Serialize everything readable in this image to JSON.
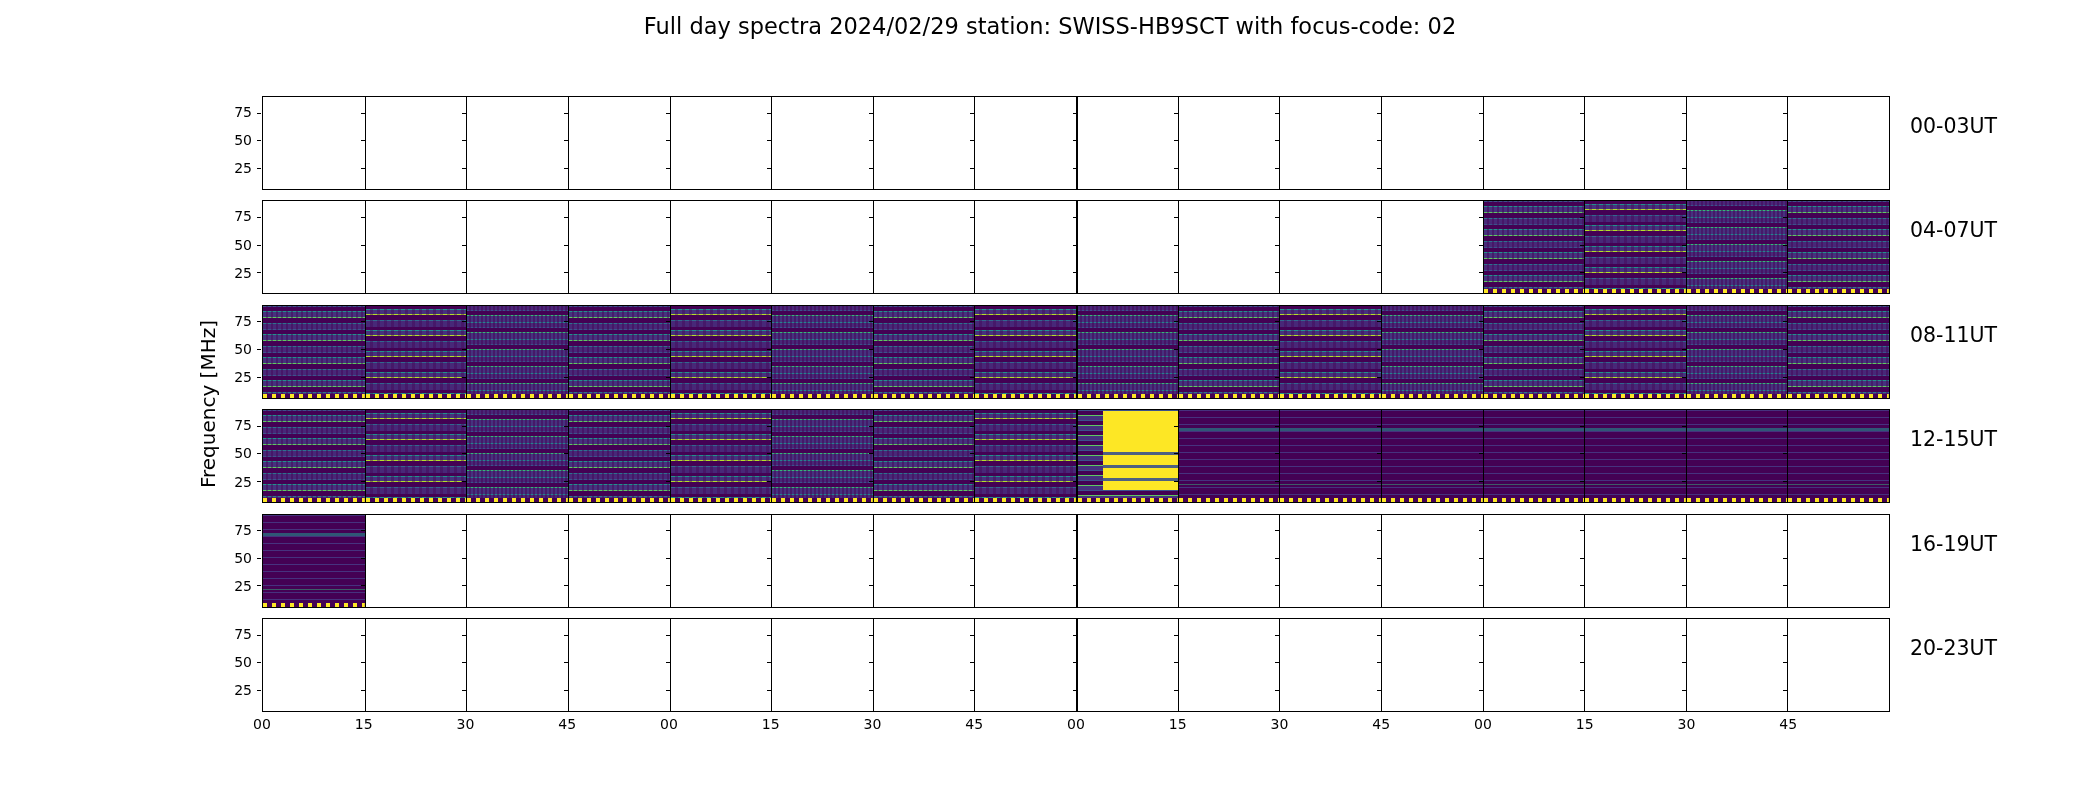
{
  "title": "Full day spectra 2024/02/29 station: SWISS-HB9SCT with focus-code: 02",
  "ylabel": "Frequency [MHz]",
  "xticks": [
    "00",
    "15",
    "30",
    "45",
    "00",
    "15",
    "30",
    "45",
    "00",
    "15",
    "30",
    "45",
    "00",
    "15",
    "30",
    "45"
  ],
  "rows": [
    {
      "label": "00-03UT",
      "yticks": [
        "75",
        "50",
        "25"
      ],
      "panels": [
        {
          "kind": "empty"
        },
        {
          "kind": "empty"
        },
        {
          "kind": "empty"
        },
        {
          "kind": "empty"
        },
        {
          "kind": "empty"
        },
        {
          "kind": "empty"
        },
        {
          "kind": "empty"
        },
        {
          "kind": "empty"
        },
        {
          "kind": "empty"
        },
        {
          "kind": "empty"
        },
        {
          "kind": "empty"
        },
        {
          "kind": "empty"
        },
        {
          "kind": "empty"
        },
        {
          "kind": "empty"
        },
        {
          "kind": "empty"
        },
        {
          "kind": "empty"
        }
      ]
    },
    {
      "label": "04-07UT",
      "yticks": [
        "75",
        "50",
        "25"
      ],
      "panels": [
        {
          "kind": "empty"
        },
        {
          "kind": "empty"
        },
        {
          "kind": "empty"
        },
        {
          "kind": "empty"
        },
        {
          "kind": "empty"
        },
        {
          "kind": "empty"
        },
        {
          "kind": "empty"
        },
        {
          "kind": "empty"
        },
        {
          "kind": "empty"
        },
        {
          "kind": "empty"
        },
        {
          "kind": "empty"
        },
        {
          "kind": "empty"
        },
        {
          "kind": "spectrum"
        },
        {
          "kind": "spectrum"
        },
        {
          "kind": "spectrum"
        },
        {
          "kind": "spectrum"
        }
      ]
    },
    {
      "label": "08-11UT",
      "yticks": [
        "75",
        "50",
        "25"
      ],
      "panels": [
        {
          "kind": "spectrum"
        },
        {
          "kind": "spectrum"
        },
        {
          "kind": "spectrum"
        },
        {
          "kind": "spectrum"
        },
        {
          "kind": "spectrum"
        },
        {
          "kind": "spectrum"
        },
        {
          "kind": "spectrum"
        },
        {
          "kind": "spectrum"
        },
        {
          "kind": "spectrum"
        },
        {
          "kind": "spectrum"
        },
        {
          "kind": "spectrum"
        },
        {
          "kind": "spectrum"
        },
        {
          "kind": "spectrum"
        },
        {
          "kind": "spectrum"
        },
        {
          "kind": "spectrum"
        },
        {
          "kind": "spectrum"
        }
      ]
    },
    {
      "label": "12-15UT",
      "yticks": [
        "75",
        "50",
        "25"
      ],
      "panels": [
        {
          "kind": "spectrum"
        },
        {
          "kind": "spectrum"
        },
        {
          "kind": "spectrum"
        },
        {
          "kind": "spectrum"
        },
        {
          "kind": "spectrum"
        },
        {
          "kind": "spectrum"
        },
        {
          "kind": "spectrum"
        },
        {
          "kind": "spectrum"
        },
        {
          "kind": "burst"
        },
        {
          "kind": "quiet"
        },
        {
          "kind": "quiet"
        },
        {
          "kind": "quiet"
        },
        {
          "kind": "quiet"
        },
        {
          "kind": "quiet"
        },
        {
          "kind": "quiet"
        },
        {
          "kind": "quiet"
        }
      ]
    },
    {
      "label": "16-19UT",
      "yticks": [
        "75",
        "50",
        "25"
      ],
      "panels": [
        {
          "kind": "quiet"
        },
        {
          "kind": "empty"
        },
        {
          "kind": "empty"
        },
        {
          "kind": "empty"
        },
        {
          "kind": "empty"
        },
        {
          "kind": "empty"
        },
        {
          "kind": "empty"
        },
        {
          "kind": "empty"
        },
        {
          "kind": "empty"
        },
        {
          "kind": "empty"
        },
        {
          "kind": "empty"
        },
        {
          "kind": "empty"
        },
        {
          "kind": "empty"
        },
        {
          "kind": "empty"
        },
        {
          "kind": "empty"
        },
        {
          "kind": "empty"
        }
      ]
    },
    {
      "label": "20-23UT",
      "yticks": [
        "75",
        "50",
        "25"
      ],
      "panels": [
        {
          "kind": "empty"
        },
        {
          "kind": "empty"
        },
        {
          "kind": "empty"
        },
        {
          "kind": "empty"
        },
        {
          "kind": "empty"
        },
        {
          "kind": "empty"
        },
        {
          "kind": "empty"
        },
        {
          "kind": "empty"
        },
        {
          "kind": "empty"
        },
        {
          "kind": "empty"
        },
        {
          "kind": "empty"
        },
        {
          "kind": "empty"
        },
        {
          "kind": "empty"
        },
        {
          "kind": "empty"
        },
        {
          "kind": "empty"
        },
        {
          "kind": "empty"
        }
      ]
    }
  ]
}
